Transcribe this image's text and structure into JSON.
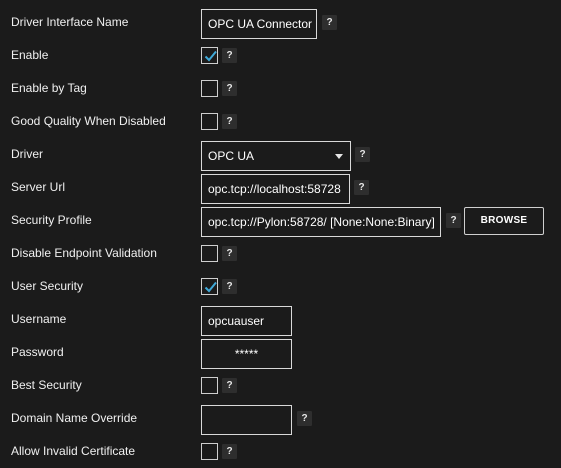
{
  "fields": {
    "driver_interface_name": {
      "label": "Driver Interface Name",
      "value": "OPC UA Connector"
    },
    "enable": {
      "label": "Enable",
      "checked": true
    },
    "enable_by_tag": {
      "label": "Enable by Tag",
      "checked": false
    },
    "good_quality_when_disabled": {
      "label": "Good Quality When Disabled",
      "checked": false
    },
    "driver": {
      "label": "Driver",
      "value": "OPC UA"
    },
    "server_url": {
      "label": "Server Url",
      "value": "opc.tcp://localhost:58728"
    },
    "security_profile": {
      "label": "Security Profile",
      "value": "opc.tcp://Pylon:58728/ [None:None:Binary]"
    },
    "disable_endpoint_validation": {
      "label": "Disable Endpoint Validation",
      "checked": false
    },
    "user_security": {
      "label": "User Security",
      "checked": true
    },
    "username": {
      "label": "Username",
      "value": "opcuauser"
    },
    "password": {
      "label": "Password",
      "value": "*****"
    },
    "best_security": {
      "label": "Best Security",
      "checked": false
    },
    "domain_name_override": {
      "label": "Domain Name Override",
      "value": ""
    },
    "allow_invalid_certificate": {
      "label": "Allow Invalid Certificate",
      "checked": false
    }
  },
  "buttons": {
    "browse": "BROWSE",
    "help": "?"
  },
  "colors": {
    "background": "#1b1b1b",
    "check_accent": "#3fa9d8",
    "help_bg": "#2e2e2e"
  },
  "icons": {
    "help": "question-mark-icon",
    "dropdown": "chevron-down-icon",
    "check": "checkmark-icon"
  }
}
